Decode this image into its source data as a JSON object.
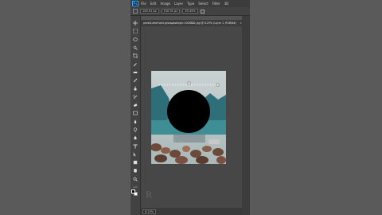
{
  "app": {
    "logo": "Ps"
  },
  "menu": [
    "File",
    "Edit",
    "Image",
    "Layer",
    "Type",
    "Select",
    "Filter",
    "3D"
  ],
  "options": {
    "width": "100.91 px",
    "height": "100.91 px",
    "zoom": "45.45%"
  },
  "document": {
    "tab_title": "pexels-eberhard-grossgasteiger-1008882.jpg @ 6.25% (Layer 1, RGB/8#)",
    "close": "×"
  },
  "status": {
    "zoom": "6.25%"
  },
  "watermark": "R",
  "colors": {
    "foreground": "#000000",
    "background": "#ffffff",
    "accent": "#31a8ff"
  },
  "tools": [
    "move-icon",
    "marquee-icon",
    "lasso-icon",
    "quick-select-icon",
    "crop-icon",
    "eyedropper-icon",
    "healing-icon",
    "brush-icon",
    "clone-stamp-icon",
    "history-brush-icon",
    "eraser-icon",
    "gradient-icon",
    "blur-icon",
    "dodge-icon",
    "pen-icon",
    "type-icon",
    "path-select-icon",
    "shape-icon",
    "hand-icon",
    "zoom-icon",
    "more-icon"
  ]
}
